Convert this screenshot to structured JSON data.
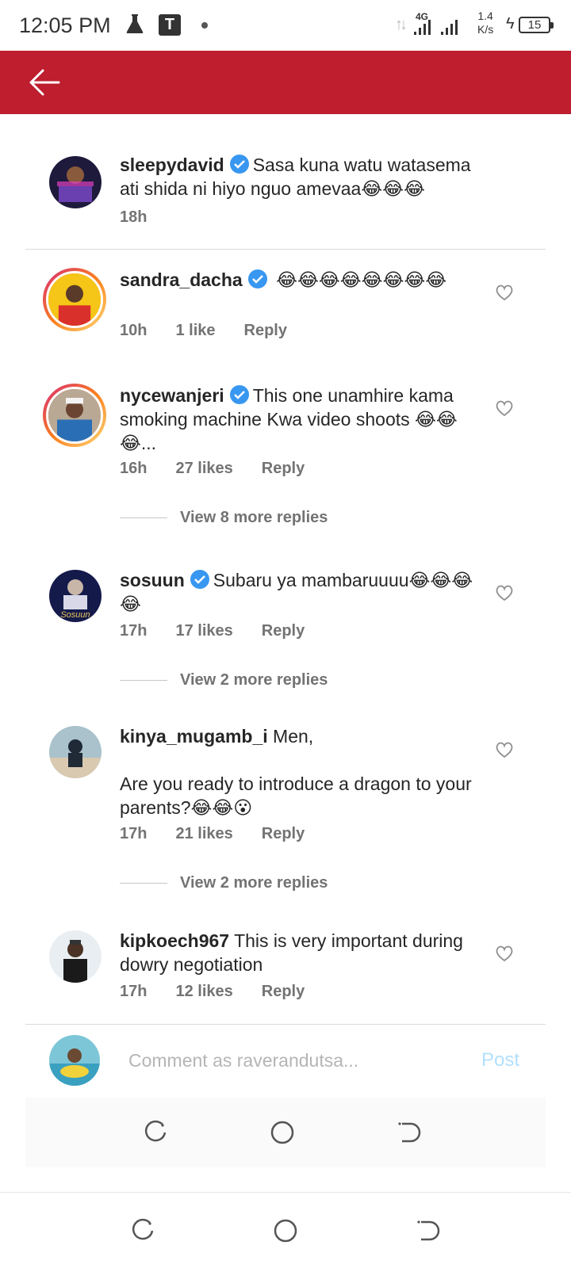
{
  "status_bar": {
    "time": "12:05 PM",
    "t_badge": "T",
    "network": "4G",
    "speed_value": "1.4",
    "speed_unit": "K/s",
    "battery": "15",
    "icons": [
      "flask-icon",
      "t-app-icon",
      "notification-dot",
      "data-arrows-icon",
      "signal-icon",
      "signal-icon-2",
      "charging-icon",
      "battery-icon"
    ]
  },
  "header": {
    "back_icon": "arrow-left-icon",
    "color": "#be1e2d"
  },
  "comments": [
    {
      "username": "sleepydavid",
      "verified": true,
      "text": "Sasa kuna watu watasema ati shida ni hiyo nguo amevaa😂😂😂",
      "time": "18h"
    },
    {
      "username": "sandra_dacha",
      "verified": true,
      "text": "😂😂😂😂😂😂😂😂",
      "time": "10h",
      "likes": "1 like",
      "reply": "Reply"
    },
    {
      "username": "nycewanjeri",
      "verified": true,
      "text": "This one unamhire kama smoking machine Kwa video shoots 😂😂😂...",
      "time": "16h",
      "likes": "27 likes",
      "reply": "Reply",
      "view_more": "View 8 more replies"
    },
    {
      "username": "sosuun",
      "verified": true,
      "text": "Subaru ya mambaruuuu😂😂😂😂",
      "time": "17h",
      "likes": "17 likes",
      "reply": "Reply",
      "view_more": "View 2 more replies"
    },
    {
      "username": "kinya_mugamb_i",
      "verified": false,
      "text_line1": "Men,",
      "text_line2": "Are you ready to introduce a dragon to your parents?😂😂😮",
      "time": "17h",
      "likes": "21 likes",
      "reply": "Reply",
      "view_more": "View 2 more replies"
    },
    {
      "username": "kipkoech967",
      "verified": false,
      "text": "This is very important during dowry negotiation",
      "time": "17h",
      "likes": "12 likes",
      "reply": "Reply"
    }
  ],
  "input": {
    "placeholder": "Comment as raverandutsa...",
    "post_label": "Post"
  },
  "nav": {
    "icons": [
      "recent-apps-icon",
      "home-icon",
      "back-icon"
    ]
  },
  "colors": {
    "header_red": "#be1e2d",
    "verified_blue": "#3897f0",
    "post_disabled": "#b2dffc",
    "meta_gray": "#737373"
  }
}
